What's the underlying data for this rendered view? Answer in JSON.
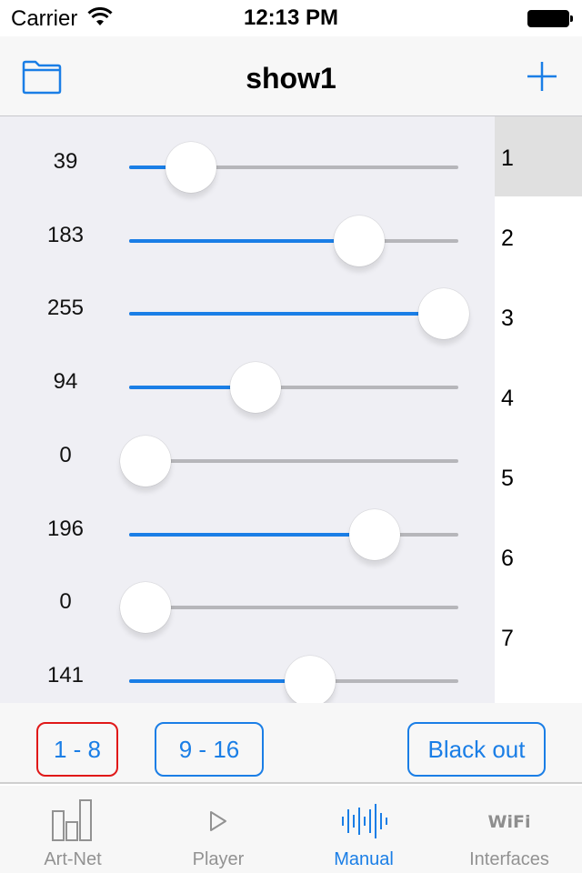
{
  "status_bar": {
    "carrier": "Carrier",
    "time": "12:13 PM",
    "wifi_icon": "wifi-icon",
    "battery_icon": "battery-full-icon"
  },
  "nav_bar": {
    "title": "show1",
    "left_icon": "folder-icon",
    "right_icon": "plus-icon"
  },
  "colors": {
    "accent": "#1a7ee6",
    "active_page_border": "#e01818",
    "track_inactive": "#b6b6ba",
    "panel_bg": "#efeff4",
    "selected_channel_bg": "#e0e0e0"
  },
  "sliders": {
    "min": 0,
    "max": 255,
    "items": [
      {
        "value": 39,
        "label": "39"
      },
      {
        "value": 183,
        "label": "183"
      },
      {
        "value": 255,
        "label": "255"
      },
      {
        "value": 94,
        "label": "94"
      },
      {
        "value": 0,
        "label": "0"
      },
      {
        "value": 196,
        "label": "196"
      },
      {
        "value": 0,
        "label": "0"
      },
      {
        "value": 141,
        "label": "141"
      }
    ]
  },
  "channel_list": {
    "selected_index": 0,
    "items": [
      {
        "label": "1"
      },
      {
        "label": "2"
      },
      {
        "label": "3"
      },
      {
        "label": "4"
      },
      {
        "label": "5"
      },
      {
        "label": "6"
      },
      {
        "label": "7"
      }
    ]
  },
  "buttons": {
    "page_1_8": "1 - 8",
    "page_9_16": "9 - 16",
    "black_out": "Black out",
    "active_page": "1 - 8"
  },
  "tab_bar": {
    "active": "Manual",
    "items": [
      {
        "label": "Art-Net",
        "icon": "bar-chart-icon"
      },
      {
        "label": "Player",
        "icon": "play-icon"
      },
      {
        "label": "Manual",
        "icon": "waveform-icon"
      },
      {
        "label": "Interfaces",
        "icon": "wifi-text-icon"
      }
    ]
  }
}
